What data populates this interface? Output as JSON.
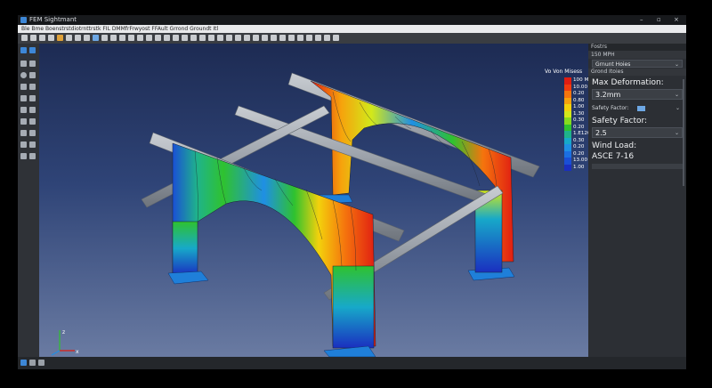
{
  "window": {
    "title": "FEM Sightmant"
  },
  "menubar": {
    "text": "Ble  Bme  Boenstrstdiotrnttrstk  FIL  DMMfrFrwyost  FFAult  Grrond  Groundt  Itl"
  },
  "toolbar": {
    "icons": [
      "#c9ccd0",
      "#c9ccd0",
      "#c9ccd0",
      "#c9ccd0",
      "#e0a23a",
      "#c9ccd0",
      "#c9ccd0",
      "#c9ccd0",
      "#6da7e4",
      "#c9ccd0",
      "#c9ccd0",
      "#c9ccd0",
      "#c9ccd0",
      "#c9ccd0",
      "#c9ccd0",
      "#c9ccd0",
      "#c9ccd0",
      "#c9ccd0",
      "#c9ccd0",
      "#c9ccd0",
      "#c9ccd0",
      "#c9ccd0",
      "#c9ccd0",
      "#c9ccd0",
      "#c9ccd0",
      "#c9ccd0",
      "#c9ccd0",
      "#c9ccd0",
      "#c9ccd0",
      "#c9ccd0",
      "#c9ccd0",
      "#c9ccd0",
      "#c9ccd0",
      "#c9ccd0",
      "#c9ccd0",
      "#c9ccd0"
    ]
  },
  "legend": {
    "title": "Vo  Von Misess",
    "colors": [
      "#e01d12",
      "#f03b0f",
      "#f5740d",
      "#f6a20c",
      "#f3d10c",
      "#d3e81a",
      "#86db1d",
      "#2fc22f",
      "#1fb38b",
      "#17a9c9",
      "#1f8fe4",
      "#1b6fe2",
      "#1a4fd6",
      "#1a2fc0"
    ],
    "labels": [
      "100 MP",
      "10.00",
      "0.20",
      "0.80",
      "1.00",
      "1.30",
      "0.30",
      "0.20",
      "1.E1200",
      "0.30",
      "0.20",
      "0.20",
      "13.00",
      "1.00"
    ]
  },
  "panel": {
    "header_label": "Fostrs",
    "wind_speed": "150 MPH",
    "ground_select": "Grnunt Hoies",
    "ground_label": "Grond Itoies",
    "max_def_label": "Max Deformation:",
    "max_def_value": "3.2mm",
    "sf_small_label": "Safety Factor:",
    "sf_label": "Safety Factor:",
    "sf_value": "2.5",
    "wind_label": "Wind Load:",
    "wind_value": "ASCE 7-16"
  }
}
